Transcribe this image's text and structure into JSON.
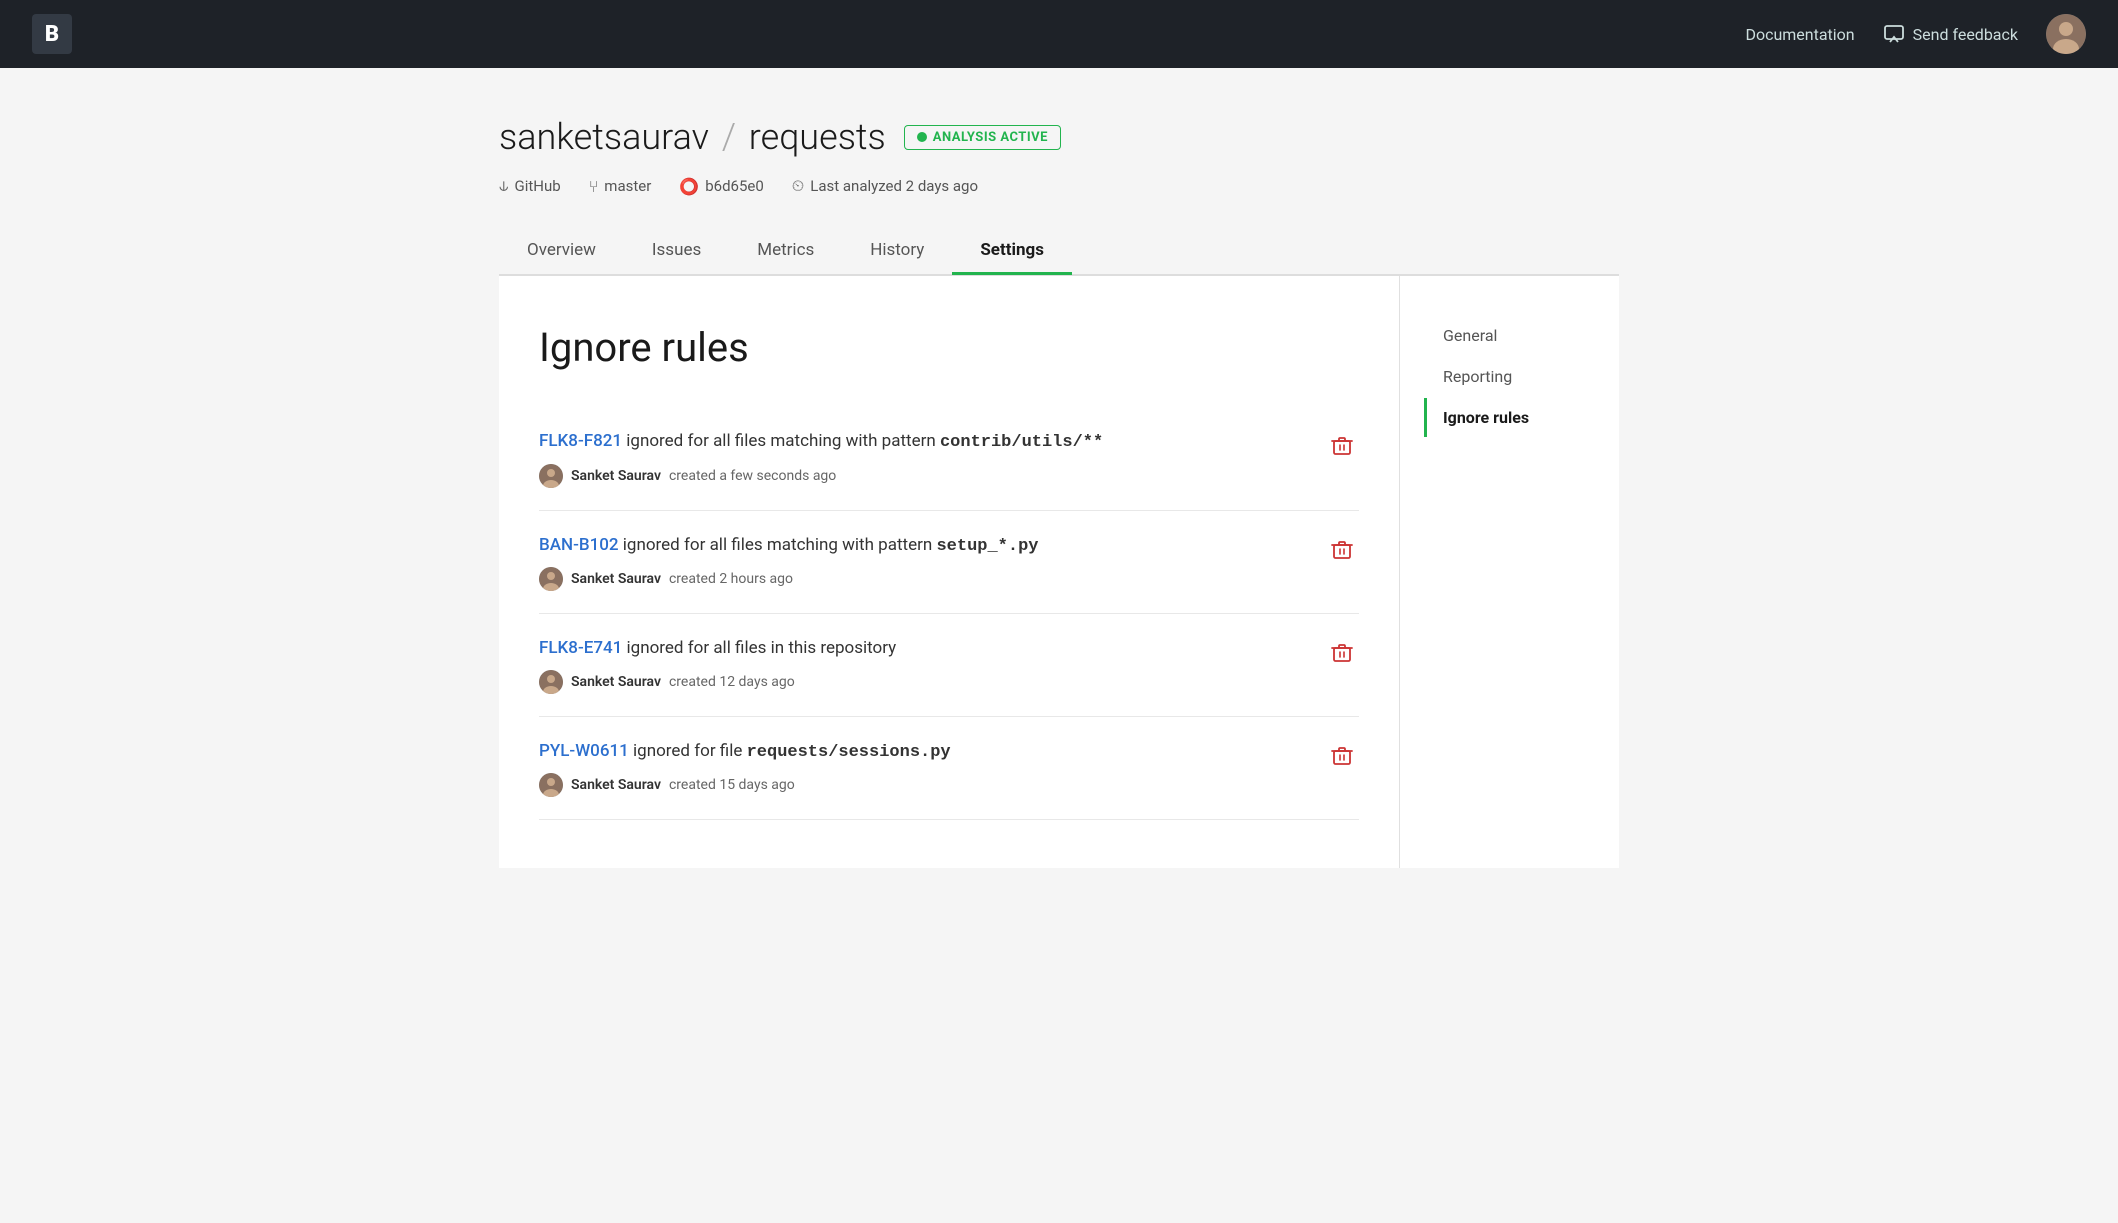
{
  "header": {
    "logo_text": "B",
    "doc_link": "Documentation",
    "feedback_label": "Send feedback",
    "avatar_label": "User avatar"
  },
  "repo": {
    "owner": "sanketsaurav",
    "name": "requests",
    "badge_text": "ANALYSIS ACTIVE",
    "meta": {
      "source": "GitHub",
      "branch": "master",
      "commit": "b6d65e0",
      "last_analyzed": "Last analyzed 2 days ago"
    }
  },
  "tabs": [
    {
      "id": "overview",
      "label": "Overview",
      "active": false
    },
    {
      "id": "issues",
      "label": "Issues",
      "active": false
    },
    {
      "id": "metrics",
      "label": "Metrics",
      "active": false
    },
    {
      "id": "history",
      "label": "History",
      "active": false
    },
    {
      "id": "settings",
      "label": "Settings",
      "active": true
    }
  ],
  "page_title": "Ignore rules",
  "ignore_rules": [
    {
      "id": "rule-1",
      "code": "FLK8-F821",
      "description": " ignored for all files matching with pattern ",
      "pattern": "contrib/utils/**",
      "author": "Sanket Saurav",
      "created": "created a few seconds ago"
    },
    {
      "id": "rule-2",
      "code": "BAN-B102",
      "description": " ignored for all files matching with pattern ",
      "pattern": "setup_*.py",
      "author": "Sanket Saurav",
      "created": "created 2 hours ago"
    },
    {
      "id": "rule-3",
      "code": "FLK8-E741",
      "description": " ignored for all files in this repository",
      "pattern": "",
      "author": "Sanket Saurav",
      "created": "created 12 days ago"
    },
    {
      "id": "rule-4",
      "code": "PYL-W0611",
      "description": " ignored for file ",
      "pattern": "requests/sessions.py",
      "author": "Sanket Saurav",
      "created": "created 15 days ago"
    }
  ],
  "sidebar": {
    "items": [
      {
        "id": "general",
        "label": "General",
        "active": false
      },
      {
        "id": "reporting",
        "label": "Reporting",
        "active": false
      },
      {
        "id": "ignore-rules",
        "label": "Ignore rules",
        "active": true
      }
    ]
  },
  "colors": {
    "accent": "#22b44e",
    "link": "#2c6fce",
    "delete": "#cc3333"
  }
}
